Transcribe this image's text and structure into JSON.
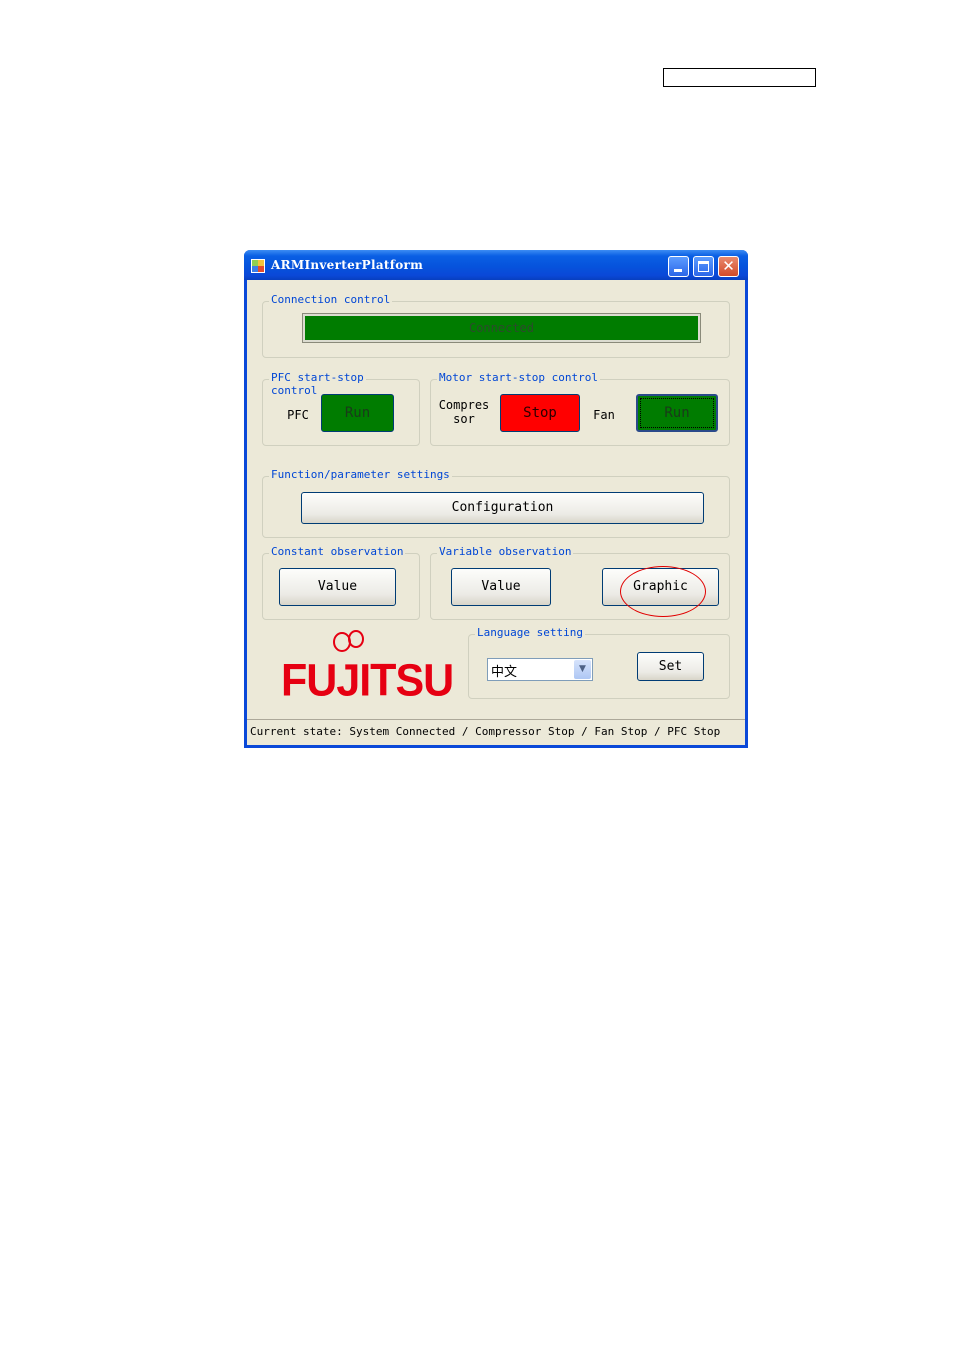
{
  "window": {
    "title": "ARMInverterPlatform"
  },
  "connection_control": {
    "legend": "Connection control",
    "status": "Connected"
  },
  "pfc_control": {
    "legend": "PFC start-stop\ncontrol",
    "label": "PFC",
    "button": "Run"
  },
  "motor_control": {
    "legend": "Motor start-stop control",
    "compressor_label": "Compres\nsor",
    "compressor_button": "Stop",
    "fan_label": "Fan",
    "fan_button": "Run"
  },
  "function_settings": {
    "legend": "Function/parameter settings",
    "button": "Configuration"
  },
  "constant_observation": {
    "legend": "Constant observation",
    "button": "Value"
  },
  "variable_observation": {
    "legend": "Variable observation",
    "value_button": "Value",
    "graphic_button": "Graphic"
  },
  "language_setting": {
    "legend": "Language setting",
    "selected": "中文",
    "set_button": "Set"
  },
  "logo": {
    "text": "FUJITSU"
  },
  "status_bar": {
    "text": "Current state: System Connected / Compressor Stop / Fan Stop / PFC Stop"
  },
  "colors": {
    "run_green": "#007c00",
    "stop_red": "#ff0000",
    "legend_blue": "#0046d5",
    "annotation_red": "#e00000",
    "titlebar_blue": "#0a48d8"
  }
}
